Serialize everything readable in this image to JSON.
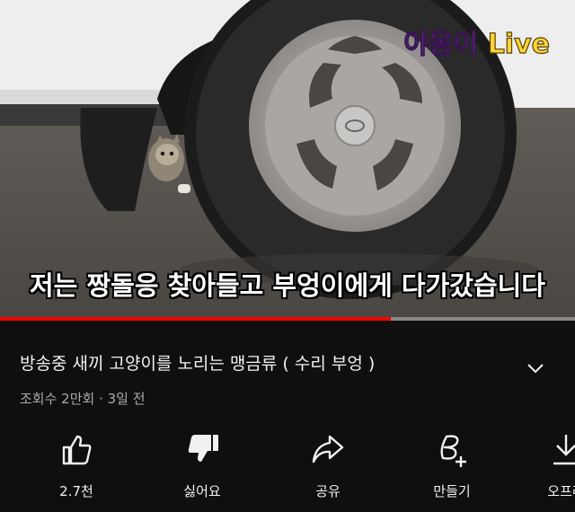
{
  "video": {
    "watermark_name": "야옹이",
    "watermark_live": "Live",
    "subtitle": "저는 짱돌응 찾아들고 부엉이에게 다가갔습니다",
    "progress_fraction": 0.68
  },
  "title": "방송중 새끼 고양이를 노리는 맹금류 ( 수리 부엉 )",
  "meta": "조회수 2만회 · 3일 전",
  "actions": [
    {
      "label": "2.7천",
      "icon": "thumbs-up-icon"
    },
    {
      "label": "싫어요",
      "icon": "thumbs-down-icon"
    },
    {
      "label": "공유",
      "icon": "share-icon"
    },
    {
      "label": "만들기",
      "icon": "remix-icon"
    },
    {
      "label": "오프라",
      "icon": "download-icon"
    }
  ]
}
